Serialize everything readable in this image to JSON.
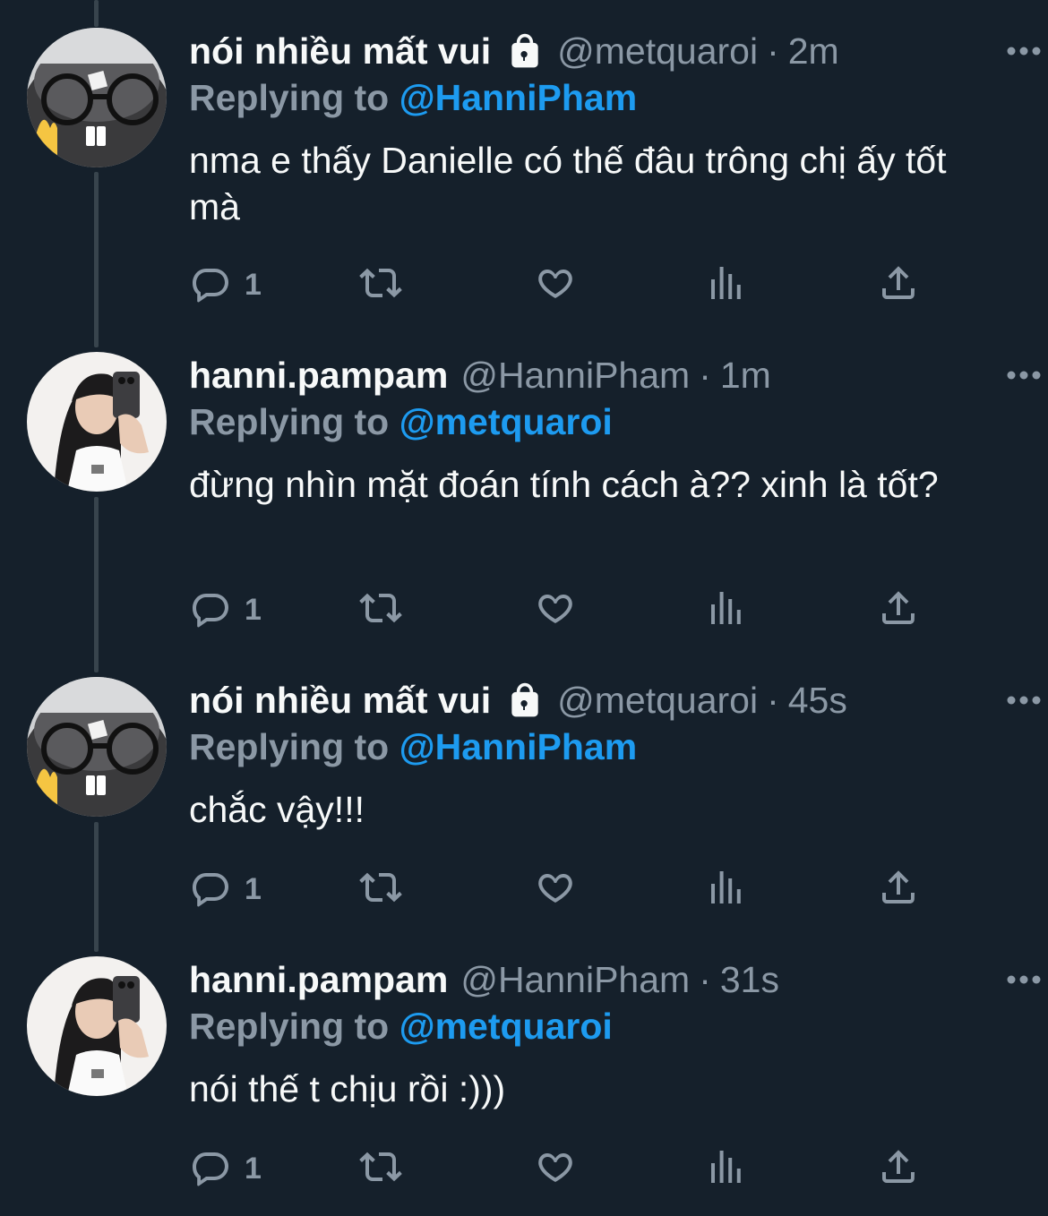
{
  "tweets": [
    {
      "display_name": "nói nhiều mất vui",
      "protected": true,
      "avatar_icon": "cat-glasses-avatar",
      "handle": "@metquaroi",
      "separator": "·",
      "time": "2m",
      "replying_prefix": "Replying to",
      "replying_handle": "@HanniPham",
      "text": "nma e thấy Danielle có thế đâu trông chị ấy tốt mà",
      "reply_count": "1"
    },
    {
      "display_name": "hanni.pampam",
      "protected": false,
      "avatar_icon": "girl-selfie-avatar",
      "handle": "@HanniPham",
      "separator": "·",
      "time": "1m",
      "replying_prefix": "Replying to",
      "replying_handle": "@metquaroi",
      "text": "đừng nhìn mặt đoán tính cách à?? xinh là tốt?",
      "reply_count": "1"
    },
    {
      "display_name": "nói nhiều mất vui",
      "protected": true,
      "avatar_icon": "cat-glasses-avatar",
      "handle": "@metquaroi",
      "separator": "·",
      "time": "45s",
      "replying_prefix": "Replying to",
      "replying_handle": "@HanniPham",
      "text": "chắc vậy!!!",
      "reply_count": "1"
    },
    {
      "display_name": "hanni.pampam",
      "protected": false,
      "avatar_icon": "girl-selfie-avatar",
      "handle": "@HanniPham",
      "separator": "·",
      "time": "31s",
      "replying_prefix": "Replying to",
      "replying_handle": "@metquaroi",
      "text": "nói thế t chịu rồi :)))",
      "reply_count": "1"
    }
  ],
  "colors": {
    "background": "#15202b",
    "text": "#f7f9f9",
    "muted": "#8b98a5",
    "accent": "#1d9bf0",
    "thread_line": "#38444d"
  },
  "icons": [
    "lock-icon",
    "more-icon",
    "reply-icon",
    "retweet-icon",
    "like-icon",
    "views-icon",
    "share-icon"
  ]
}
